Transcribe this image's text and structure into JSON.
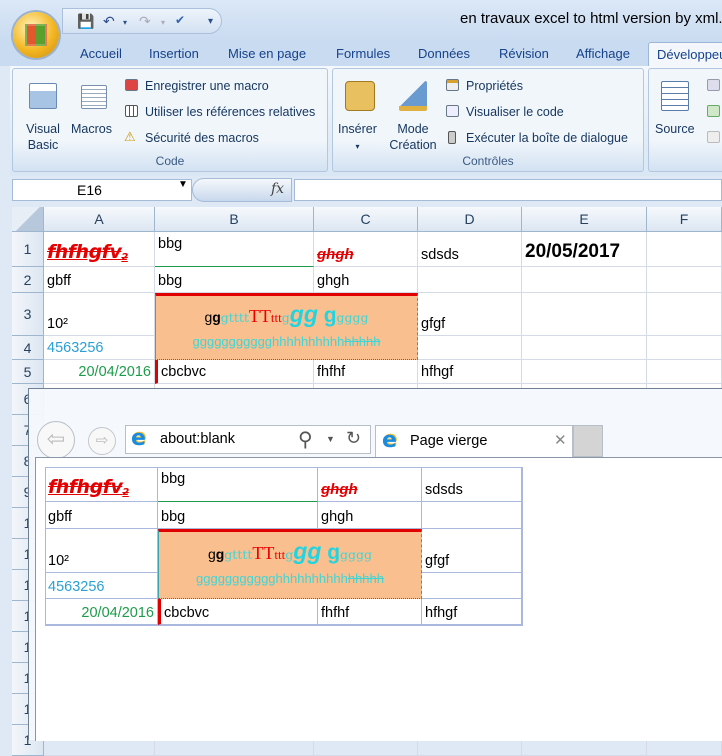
{
  "excel": {
    "title": "en travaux excel to html version by xml.x",
    "qat": {
      "save_icon": "save-icon",
      "undo_icon": "undo-icon",
      "redo_icon": "redo-icon",
      "spelling_icon": "spelling-icon",
      "customize_icon": "customize-icon"
    },
    "tabs": [
      "Accueil",
      "Insertion",
      "Mise en page",
      "Formules",
      "Données",
      "Révision",
      "Affichage",
      "Développeur"
    ],
    "active_tab": "Développeur",
    "ribbon": {
      "code": {
        "label": "Code",
        "visual_basic": "Visual Basic",
        "visual_basic_l1": "Visual",
        "visual_basic_l2": "Basic",
        "macros": "Macros",
        "record": "Enregistrer une macro",
        "relative": "Utiliser les références relatives",
        "security": "Sécurité des macros"
      },
      "controls": {
        "label": "Contrôles",
        "insert": "Insérer",
        "design_l1": "Mode",
        "design_l2": "Création",
        "properties": "Propriétés",
        "view_code": "Visualiser le code",
        "run_dialog": "Exécuter la boîte de dialogue"
      },
      "xml": {
        "source": "Source"
      }
    },
    "name_box": "E16",
    "fx": "fx",
    "columns": [
      "A",
      "B",
      "C",
      "D",
      "E",
      "F"
    ],
    "rows": [
      "1",
      "2",
      "3",
      "4",
      "5",
      "6",
      "7",
      "8",
      "9",
      "1",
      "1",
      "1",
      "1",
      "1",
      "1",
      "1",
      "1",
      "1",
      "1",
      "1"
    ],
    "cells": [
      {
        "ref": "A1",
        "text": "fhfhgfv",
        "sup": "2",
        "style": "a1"
      },
      {
        "ref": "B1",
        "text": "bbg",
        "style": "b1"
      },
      {
        "ref": "C1",
        "text": "ghgh",
        "style": "c1"
      },
      {
        "ref": "D1",
        "text": "sdsds"
      },
      {
        "ref": "E1",
        "text": "20/05/2017",
        "style": "e1"
      },
      {
        "ref": "A2",
        "text": "gbff"
      },
      {
        "ref": "B2",
        "text": "bbg"
      },
      {
        "ref": "C2",
        "text": "ghgh"
      },
      {
        "ref": "A3",
        "text": "10²"
      },
      {
        "ref": "D3",
        "text": "gfgf"
      },
      {
        "ref": "A4",
        "text": "4563256",
        "style": "blue"
      },
      {
        "ref": "A5",
        "text": "20/04/2016",
        "style": "green"
      },
      {
        "ref": "B5",
        "text": "cbcbvc",
        "style": "b5"
      },
      {
        "ref": "C5",
        "text": "fhfhf"
      },
      {
        "ref": "D5",
        "text": "hfhgf"
      }
    ],
    "merged": {
      "range": "B3:C4",
      "fill": "#F9BF8F",
      "line1": [
        {
          "t": "g",
          "s": "black"
        },
        {
          "t": "g",
          "s": "black-bold"
        },
        {
          "t": "gtttt",
          "s": "cyan-small"
        },
        {
          "t": "TT",
          "s": "red-big"
        },
        {
          "t": "ttt",
          "s": "red-small"
        },
        {
          "t": "g",
          "s": "cyan-small"
        },
        {
          "t": "gg",
          "s": "cyan-bigit"
        },
        {
          "t": " g",
          "s": "cyan-big"
        },
        {
          "t": "gggg",
          "s": "cyan-small"
        }
      ],
      "line2": [
        {
          "t": "ggggggggggg",
          "s": "cyan-ul"
        },
        {
          "t": "hhhhhhhhhh",
          "s": "cyan"
        },
        {
          "t": "hhhhh",
          "s": "cyan-strike"
        }
      ]
    }
  },
  "ie": {
    "address": "about:blank",
    "tab_title": "Page vierge",
    "icons": {
      "back": "back-icon",
      "forward": "forward-icon",
      "search": "search-icon",
      "refresh": "refresh-icon",
      "close": "close-icon"
    },
    "cells": [
      {
        "ref": "A1",
        "text": "fhfhgfv",
        "sup": "2",
        "style": "a1"
      },
      {
        "ref": "B1",
        "text": "bbg",
        "style": "b1"
      },
      {
        "ref": "C1",
        "text": "ghgh",
        "style": "c1"
      },
      {
        "ref": "D1",
        "text": "sdsds"
      },
      {
        "ref": "A2",
        "text": "gbff"
      },
      {
        "ref": "B2",
        "text": "bbg"
      },
      {
        "ref": "C2",
        "text": "ghgh"
      },
      {
        "ref": "D2",
        "text": ""
      },
      {
        "ref": "A3",
        "text": "10²"
      },
      {
        "ref": "D3",
        "text": "gfgf"
      },
      {
        "ref": "A4",
        "text": "4563256",
        "style": "blue"
      },
      {
        "ref": "D4",
        "text": ""
      },
      {
        "ref": "A5",
        "text": "20/04/2016",
        "style": "green"
      },
      {
        "ref": "B5",
        "text": "cbcbvc",
        "style": "b5"
      },
      {
        "ref": "C5",
        "text": "fhfhf"
      },
      {
        "ref": "D5",
        "text": "hfhgf"
      }
    ]
  },
  "colors": {
    "merged_fill": "#F9BF8F",
    "accent_red": "#E40000",
    "date_green": "#1E9B4A",
    "number_blue": "#2AA0D4"
  }
}
